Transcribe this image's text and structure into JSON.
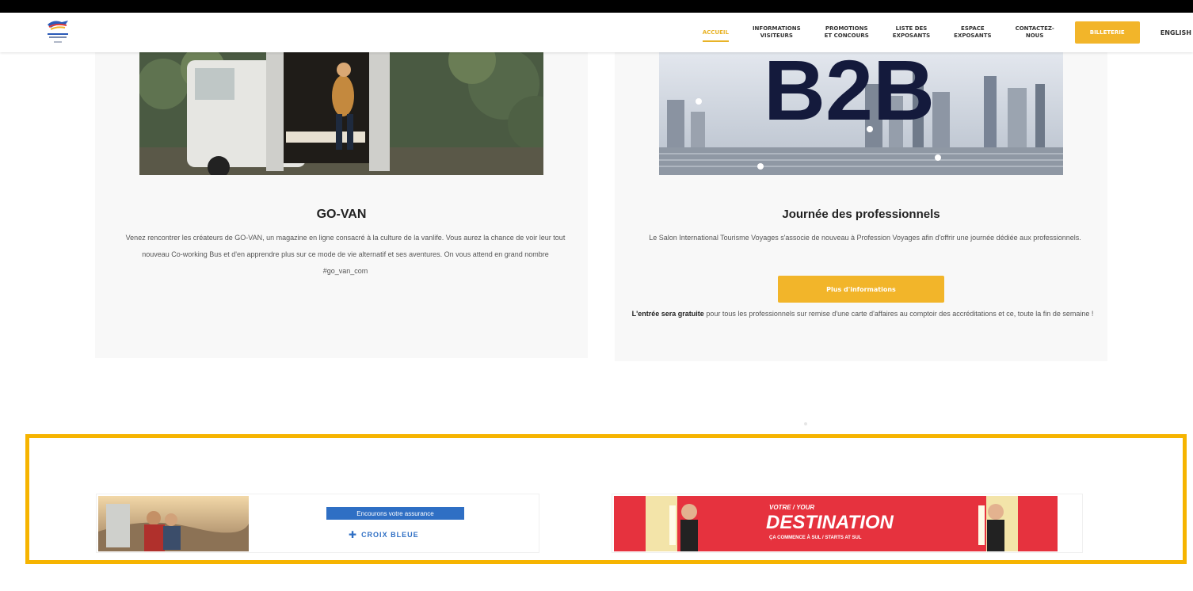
{
  "header": {
    "logo_name": "salon-logo",
    "nav": [
      {
        "label": "ACCUEIL",
        "active": true
      },
      {
        "label": "INFORMATIONS\nVISITEURS",
        "active": false
      },
      {
        "label": "PROMOTIONS\nET CONCOURS",
        "active": false
      },
      {
        "label": "LISTE DES\nEXPOSANTS",
        "active": false
      },
      {
        "label": "ESPACE\nEXPOSANTS",
        "active": false
      },
      {
        "label": "CONTACTEZ-\nNOUS",
        "active": false
      }
    ],
    "cta_label": "BILLETERIE",
    "lang_label": "ENGLISH"
  },
  "cards": {
    "left": {
      "image_alt": "van-with-woman-photo",
      "title": "GO-VAN",
      "text": "Venez rencontrer les créateurs de GO-VAN, un magazine en ligne consacré à la culture de la vanlife. Vous aurez la chance de voir leur tout nouveau Co-working Bus et d'en apprendre plus sur ce mode de vie alternatif et ses aventures. On vous attend en grand nombre #go_van_com"
    },
    "right": {
      "image_text": "B2B",
      "title": "Journée des professionnels",
      "text": "Le Salon International Tourisme Voyages s'associe de nouveau à Profession Voyages afin d'offrir une journée dédiée aux professionnels.",
      "button_label": "Plus d'informations",
      "footer_bold": "L'entrée sera gratuite",
      "footer_text": " pour tous les professionnels sur remise d'une carte d'affaires au comptoir des accréditations et ce, toute la fin de semaine !"
    }
  },
  "sponsors": {
    "left_badge": "Encourons votre assurance",
    "left_brand": "CROIX BLEUE",
    "right_headline_small": "VOTRE / YOUR",
    "right_headline": "DESTINATION",
    "right_sub": "ÇA COMMENCE À SUL / STARTS AT SUL"
  },
  "colors": {
    "accent": "#f2b52a",
    "strip_border": "#f6b400",
    "banner_red": "#e6323e"
  }
}
